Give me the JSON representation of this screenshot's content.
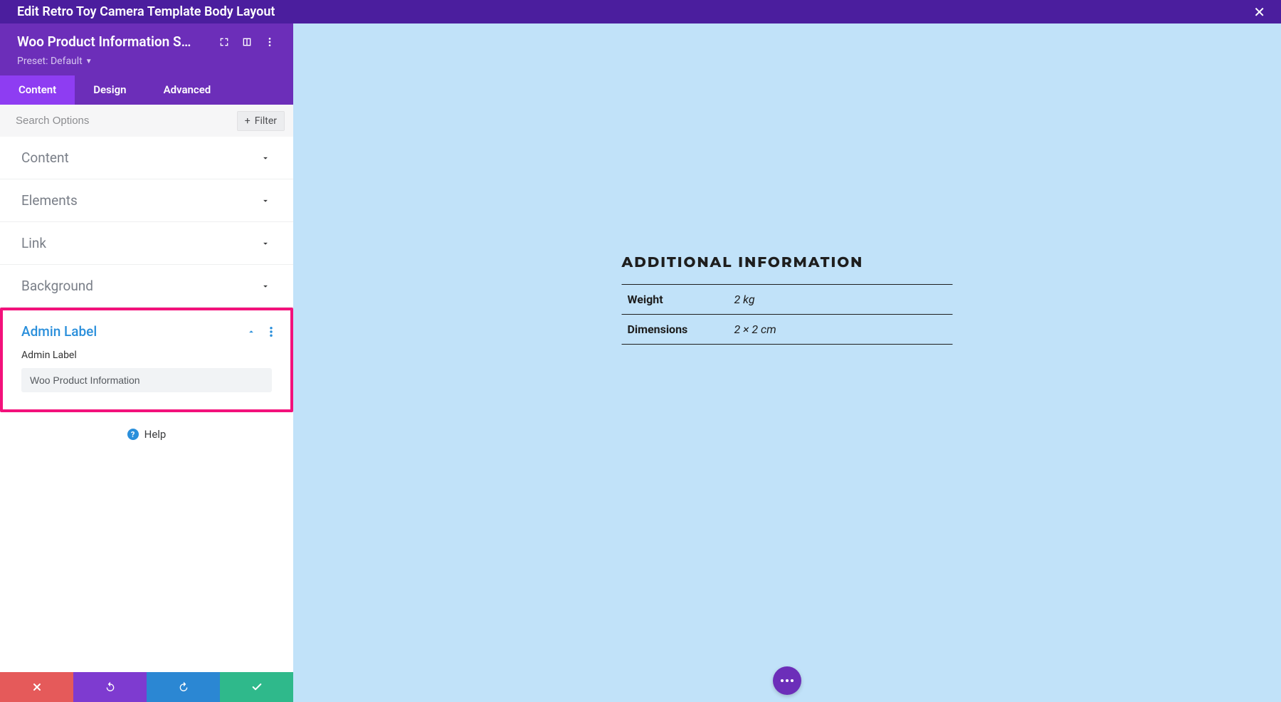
{
  "titlebar": {
    "title": "Edit Retro Toy Camera Template Body Layout"
  },
  "module": {
    "title": "Woo Product Information S…",
    "preset_label": "Preset: Default"
  },
  "tabs": [
    {
      "label": "Content",
      "active": true
    },
    {
      "label": "Design",
      "active": false
    },
    {
      "label": "Advanced",
      "active": false
    }
  ],
  "search": {
    "placeholder": "Search Options",
    "filter_label": "Filter"
  },
  "sections": [
    {
      "title": "Content"
    },
    {
      "title": "Elements"
    },
    {
      "title": "Link"
    },
    {
      "title": "Background"
    }
  ],
  "admin_label_section": {
    "title": "Admin Label",
    "field_label": "Admin Label",
    "value": "Woo Product Information"
  },
  "help_label": "Help",
  "preview": {
    "heading": "ADDITIONAL INFORMATION",
    "rows": [
      {
        "key": "Weight",
        "val": "2 kg"
      },
      {
        "key": "Dimensions",
        "val": "2 × 2 cm"
      }
    ]
  }
}
